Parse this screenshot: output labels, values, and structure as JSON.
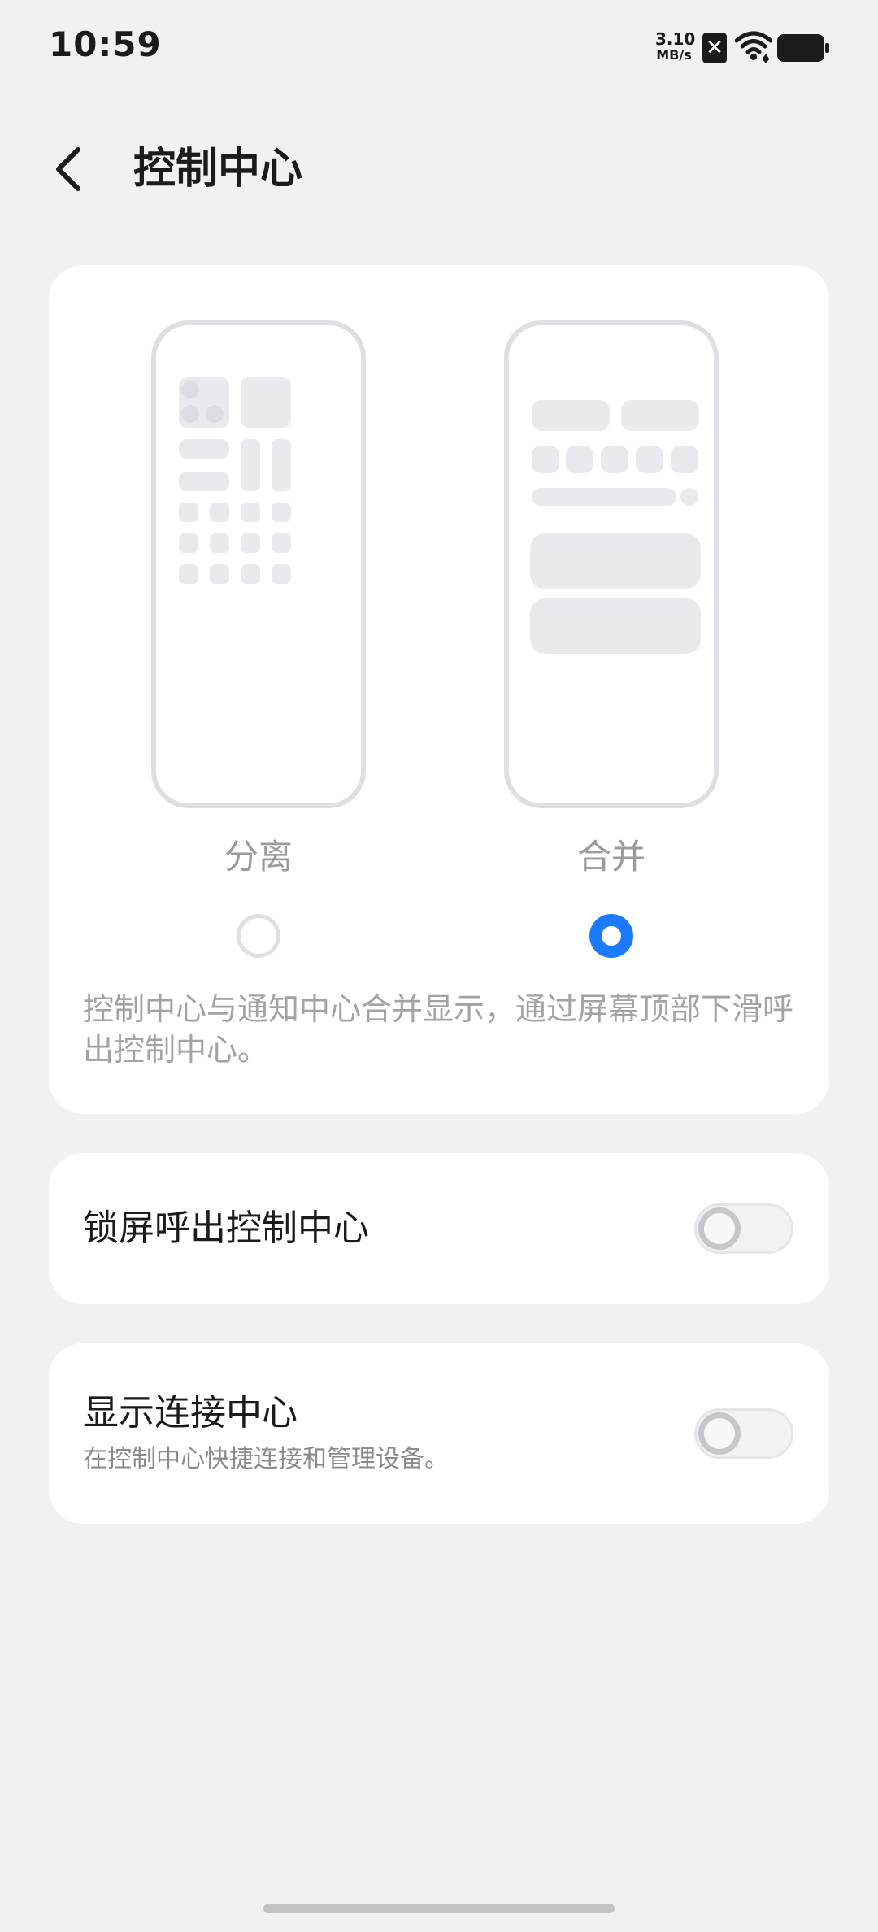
{
  "status_bar": {
    "time": "10:59",
    "net_speed_value": "3.10",
    "net_speed_unit": "MB/s",
    "sim_icon": "sim-x-icon",
    "wifi_icon": "wifi-icon",
    "battery_icon": "battery-icon"
  },
  "header": {
    "back_icon": "chevron-left-icon",
    "title": "控制中心"
  },
  "mode_selector": {
    "options": [
      {
        "label": "分离",
        "selected": false
      },
      {
        "label": "合并",
        "selected": true
      }
    ],
    "description": "控制中心与通知中心合并显示，通过屏幕顶部下滑呼出控制中心。"
  },
  "settings": {
    "lock_screen": {
      "title": "锁屏呼出控制中心",
      "enabled": false
    },
    "connection_center": {
      "title": "显示连接中心",
      "subtitle": "在控制中心快捷连接和管理设备。",
      "enabled": false
    }
  },
  "colors": {
    "background": "#f1f1f4",
    "card": "#ffffff",
    "accent": "#1a7bff",
    "placeholder": "#e9e9ee",
    "secondary_text": "#a2a2a7"
  }
}
